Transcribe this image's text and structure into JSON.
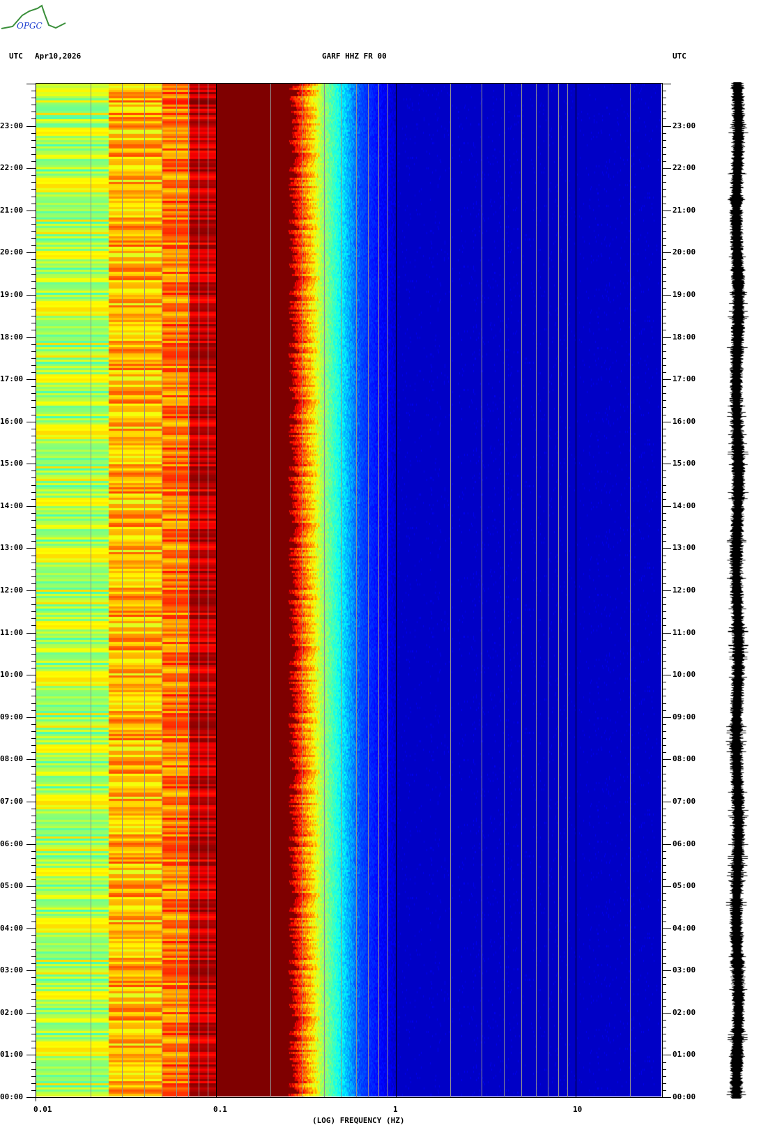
{
  "header": {
    "left_tz": "UTC",
    "date": "Apr10,2026",
    "station": "GARF HHZ FR 00",
    "right_tz": "UTC"
  },
  "logo": {
    "text": "OPGC"
  },
  "chart_data": {
    "type": "heatmap",
    "title": "GARF HHZ FR 00",
    "xlabel": "(LOG) FREQUENCY (HZ)",
    "ylabel": "UTC",
    "x_scale": "log",
    "xlim": [
      0.01,
      30
    ],
    "ylim_hours": [
      0,
      24
    ],
    "x_ticks": [
      {
        "value": 0.01,
        "label": "0.01"
      },
      {
        "value": 0.1,
        "label": "0.1"
      },
      {
        "value": 1,
        "label": "1"
      },
      {
        "value": 10,
        "label": "10"
      }
    ],
    "y_ticks": [
      "00:00",
      "01:00",
      "02:00",
      "03:00",
      "04:00",
      "05:00",
      "06:00",
      "07:00",
      "08:00",
      "09:00",
      "10:00",
      "11:00",
      "12:00",
      "13:00",
      "14:00",
      "15:00",
      "16:00",
      "17:00",
      "18:00",
      "19:00",
      "20:00",
      "21:00",
      "22:00",
      "23:00"
    ],
    "colormap": "jet",
    "band_profile": [
      {
        "f_range": [
          0.01,
          0.025
        ],
        "level": "yellow-green with cyan/red stripes"
      },
      {
        "f_range": [
          0.025,
          0.07
        ],
        "level": "orange-yellow with red stripes"
      },
      {
        "f_range": [
          0.07,
          0.1
        ],
        "level": "dark red with red stripes"
      },
      {
        "f_range": [
          0.1,
          0.27
        ],
        "level": "dark red (max)"
      },
      {
        "f_range": [
          0.27,
          0.6
        ],
        "level": "red to yellow to cyan transition"
      },
      {
        "f_range": [
          0.6,
          30
        ],
        "level": "blue to dark blue (min)"
      }
    ],
    "grid": true
  },
  "colors": {
    "dark_red": "#800000",
    "dark_blue": "#0000a0"
  }
}
